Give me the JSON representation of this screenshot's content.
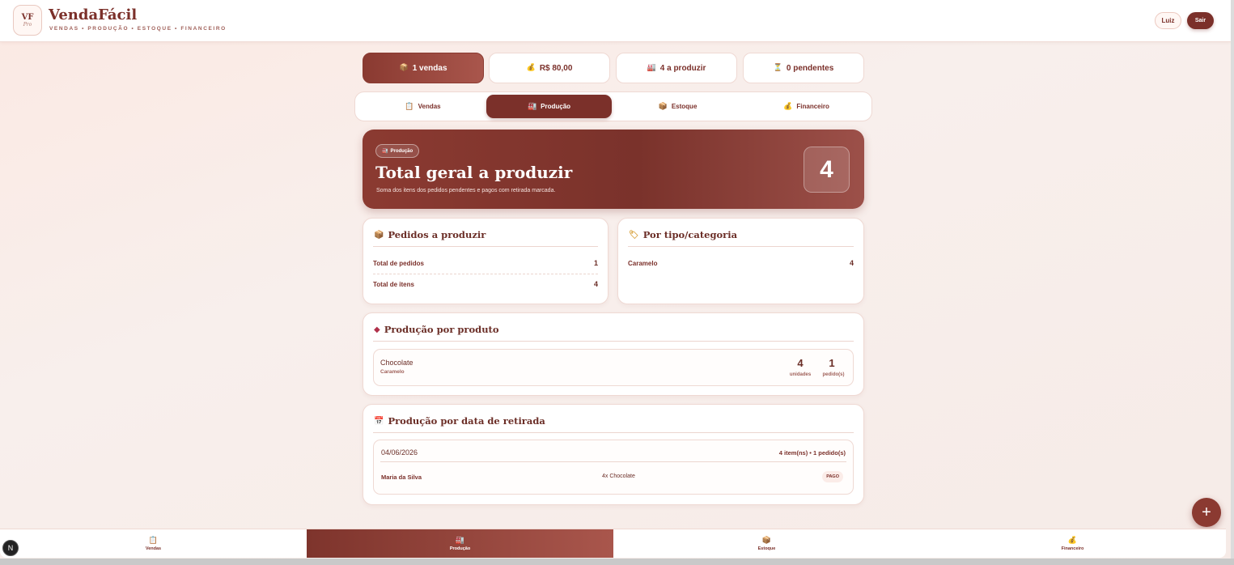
{
  "app": {
    "logo_main": "VF",
    "logo_sub": "Pro",
    "title": "VendaFácil",
    "subtitle": "VENDAS • PRODUÇÃO • ESTOQUE • FINANCEIRO",
    "user_label": "Luiz",
    "logout_label": "Sair"
  },
  "stats": [
    {
      "icon": "📦",
      "label": "1 vendas",
      "icon_name": "package-icon"
    },
    {
      "icon": "💰",
      "label": "R$ 80,00",
      "icon_name": "money-bag-icon"
    },
    {
      "icon": "🏭",
      "label": "4 a produzir",
      "icon_name": "factory-icon"
    },
    {
      "icon": "⏳",
      "label": "0 pendentes",
      "icon_name": "hourglass-icon"
    }
  ],
  "tabs": [
    {
      "icon": "📋",
      "label": "Vendas"
    },
    {
      "icon": "🏭",
      "label": "Produção"
    },
    {
      "icon": "📦",
      "label": "Estoque"
    },
    {
      "icon": "💰",
      "label": "Financeiro"
    }
  ],
  "active_tab": "Produção",
  "hero": {
    "badge_icon": "🏭",
    "badge_label": "Produção",
    "title": "Total geral a produzir",
    "subtitle": "Soma dos itens dos pedidos pendentes e pagos com retirada marcada.",
    "total": "4"
  },
  "orders_card": {
    "icon": "📦",
    "title": "Pedidos a produzir",
    "rows": [
      {
        "label": "Total de pedidos",
        "value": "1"
      },
      {
        "label": "Total de itens",
        "value": "4"
      }
    ]
  },
  "category_card": {
    "icon": "🏷",
    "title": "Por tipo/categoria",
    "rows": [
      {
        "label": "Caramelo",
        "value": "4"
      }
    ]
  },
  "product_card": {
    "icon": "◆",
    "title": "Produção por produto",
    "items": [
      {
        "name": "Chocolate",
        "category": "Caramelo",
        "units": "4",
        "units_label": "unidades",
        "orders": "1",
        "orders_label": "pedido(s)"
      }
    ]
  },
  "date_card": {
    "icon": "📅",
    "title": "Produção por data de retirada",
    "groups": [
      {
        "date": "04/06/2026",
        "summary": "4 item(ns) • 1 pedido(s)",
        "orders": [
          {
            "customer": "Maria da Silva",
            "items": "4x Chocolate",
            "status": "PAGO"
          }
        ]
      }
    ]
  },
  "fab_label": "+",
  "bottom_nav": [
    {
      "icon": "📋",
      "label": "Vendas"
    },
    {
      "icon": "🏭",
      "label": "Produção"
    },
    {
      "icon": "📦",
      "label": "Estoque"
    },
    {
      "icon": "💰",
      "label": "Financeiro"
    }
  ],
  "dev_badge": "N",
  "colors": {
    "primary": "#7b302a",
    "primary_light": "#a9564c",
    "background": "#f8efec",
    "border": "#efd9d3"
  }
}
